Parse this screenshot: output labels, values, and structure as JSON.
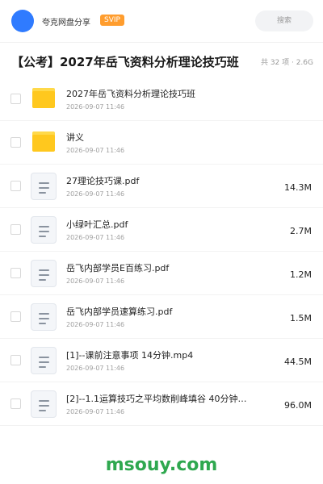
{
  "header": {
    "username": "夸克网盘分享",
    "badge": "SVIP",
    "search_placeholder": "搜索"
  },
  "share": {
    "title": "【公考】2027年岳飞资料分析理论技巧班",
    "meta": "共 32 项 · 2.6G"
  },
  "files": [
    {
      "type": "folder",
      "name": "2027年岳飞资料分析理论技巧班",
      "date": "2026-09-07 11:46",
      "size": ""
    },
    {
      "type": "folder",
      "name": "讲义",
      "date": "2026-09-07 11:46",
      "size": ""
    },
    {
      "type": "document",
      "name": "27理论技巧课.pdf",
      "date": "2026-09-07 11:46",
      "size": "14.3M"
    },
    {
      "type": "document",
      "name": "小绿叶汇总.pdf",
      "date": "2026-09-07 11:46",
      "size": "2.7M"
    },
    {
      "type": "document",
      "name": "岳飞内部学员E百练习.pdf",
      "date": "2026-09-07 11:46",
      "size": "1.2M"
    },
    {
      "type": "document",
      "name": "岳飞内部学员速算练习.pdf",
      "date": "2026-09-07 11:46",
      "size": "1.5M"
    },
    {
      "type": "document",
      "name": "[1]--课前注意事项 14分钟.mp4",
      "date": "2026-09-07 11:46",
      "size": "44.5M"
    },
    {
      "type": "document",
      "name": "[2]--1.1运算技巧之平均数削峰填谷 40分钟…",
      "date": "2026-09-07 11:46",
      "size": "96.0M"
    }
  ],
  "watermark": "msouy.com",
  "colors": {
    "avatar": "#2f7bff",
    "svip_badge": "#ff9d2e",
    "folder": "#ffc81e",
    "watermark": "#2fa84f"
  }
}
